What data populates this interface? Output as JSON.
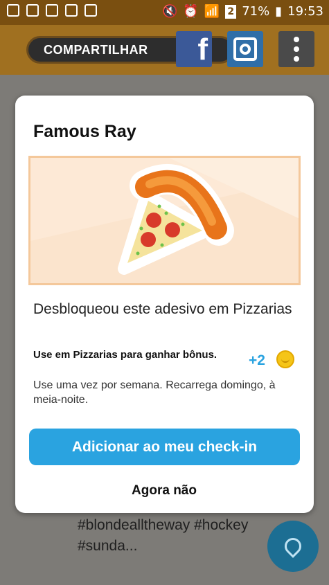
{
  "status_bar": {
    "signal_sim": "2",
    "battery": "71%",
    "time": "19:53"
  },
  "header": {
    "share_label": "COMPARTILHAR",
    "facebook_glyph": "f",
    "icons": [
      "facebook-icon",
      "instagram-icon",
      "more-vert-icon"
    ]
  },
  "background": {
    "caption": "#blondealltheway #hockey #sunda..."
  },
  "modal": {
    "title": "Famous Ray",
    "sticker_icon": "pizza-slice-sticker",
    "description": "Desbloqueou este adesivo em Pizzarias",
    "bonus_title": "Use em Pizzarias para ganhar bônus.",
    "bonus_points": "+2",
    "bonus_description": "Use uma vez por semana. Recarrega domingo, à meia-noite.",
    "primary_button": "Adicionar ao meu check-in",
    "secondary_button": "Agora não"
  },
  "colors": {
    "accent": "#2aa3e0",
    "banner_bg": "#fbe4cd",
    "facebook": "#3b5998",
    "coin": "#f5c518"
  }
}
